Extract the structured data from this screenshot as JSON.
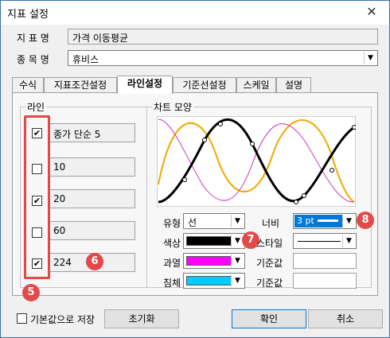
{
  "window": {
    "title": "지표 설정",
    "close": "✕"
  },
  "fields": {
    "indicator_name_label": "지 표 명",
    "indicator_name_value": "가격 이동평균",
    "item_name_label": "종 목 명",
    "item_name_value": "휴비스"
  },
  "tabs": [
    {
      "label": "수식"
    },
    {
      "label": "지표조건설정"
    },
    {
      "label": "라인설정",
      "active": true
    },
    {
      "label": "기준선설정"
    },
    {
      "label": "스케일"
    },
    {
      "label": "설명"
    }
  ],
  "lines_group": {
    "title": "라인",
    "items": [
      {
        "label": "종가 단순 5",
        "checked": true
      },
      {
        "label": "10",
        "checked": false
      },
      {
        "label": "20",
        "checked": true
      },
      {
        "label": "60",
        "checked": false
      },
      {
        "label": "224",
        "checked": true
      }
    ]
  },
  "chart_group": {
    "title": "차트 모양",
    "type_label": "유형",
    "type_value": "선",
    "width_label": "너비",
    "width_value": "3 pt",
    "color_label": "색상",
    "color_value": "#000000",
    "style_label": "스타일",
    "overheat_label": "과열",
    "overheat_color": "#ff00ff",
    "overheat_base_label": "기준값",
    "oversold_label": "침체",
    "oversold_color": "#00ccff",
    "oversold_base_label": "기준값"
  },
  "annotations": {
    "badge5": "5",
    "badge6": "6",
    "badge7": "7",
    "badge8": "8"
  },
  "footer": {
    "save_default_label": "기본값으로 저장",
    "reset_label": "초기화",
    "ok_label": "확인",
    "cancel_label": "취소"
  },
  "colors": {
    "accent": "#e24a4a",
    "curve_black": "#000000",
    "curve_orange": "#f0a800",
    "curve_magenta": "#d030c0",
    "selection_blue": "#0078d7"
  }
}
